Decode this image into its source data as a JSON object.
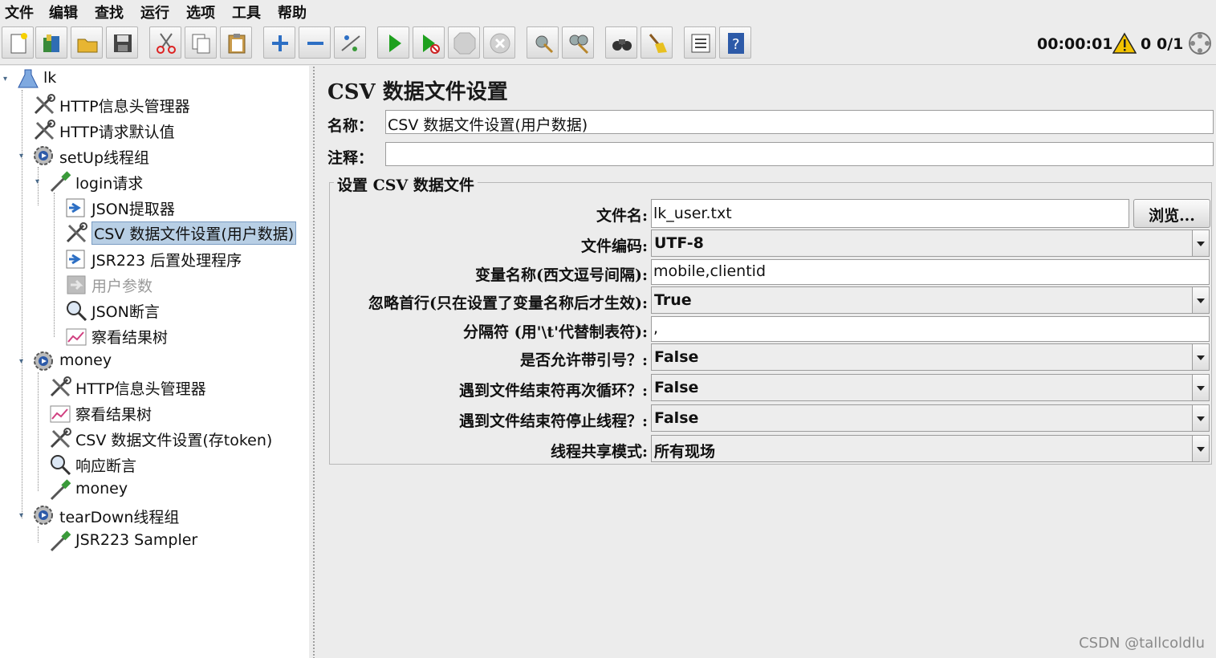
{
  "menu": [
    "文件",
    "编辑",
    "查找",
    "运行",
    "选项",
    "工具",
    "帮助"
  ],
  "toolbar": {
    "icons": [
      "new-icon",
      "templates-icon",
      "open-icon",
      "save-icon",
      "cut-icon",
      "copy-icon",
      "paste-icon",
      "expand-icon",
      "collapse-icon",
      "toggle-icon",
      "start-icon",
      "start-no-pause-icon",
      "stop-icon",
      "shutdown-icon",
      "clear-icon",
      "clear-all-icon",
      "search-icon",
      "reset-search-icon",
      "function-helper-icon",
      "help-icon"
    ],
    "timer": "00:00:01",
    "warning_count": "0",
    "threads": "0/1"
  },
  "tree": {
    "nodes": [
      {
        "label": "lk",
        "icon": "test-plan-icon"
      },
      {
        "label": "HTTP信息头管理器",
        "icon": "config-tool-icon"
      },
      {
        "label": "HTTP请求默认值",
        "icon": "config-tool-icon"
      },
      {
        "label": "setUp线程组",
        "icon": "thread-group-gear-icon"
      },
      {
        "label": "login请求",
        "icon": "sampler-pipette-icon"
      },
      {
        "label": "JSON提取器",
        "icon": "post-processor-icon"
      },
      {
        "label": "CSV 数据文件设置(用户数据)",
        "icon": "config-tool-icon"
      },
      {
        "label": "JSR223 后置处理程序",
        "icon": "post-processor-icon"
      },
      {
        "label": "用户参数",
        "icon": "pre-processor-icon"
      },
      {
        "label": "JSON断言",
        "icon": "assertion-magnifier-icon"
      },
      {
        "label": "察看结果树",
        "icon": "listener-graph-icon"
      },
      {
        "label": "money",
        "icon": "thread-group-gear-icon"
      },
      {
        "label": "HTTP信息头管理器",
        "icon": "config-tool-icon"
      },
      {
        "label": "察看结果树",
        "icon": "listener-graph-icon"
      },
      {
        "label": "CSV 数据文件设置(存token)",
        "icon": "config-tool-icon"
      },
      {
        "label": "响应断言",
        "icon": "assertion-magnifier-icon"
      },
      {
        "label": "money",
        "icon": "sampler-pipette-icon"
      },
      {
        "label": "tearDown线程组",
        "icon": "thread-group-gear-icon"
      },
      {
        "label": "JSR223 Sampler",
        "icon": "sampler-pipette-icon"
      }
    ]
  },
  "panel": {
    "title": "CSV 数据文件设置",
    "name_label": "名称：",
    "name_value": "CSV 数据文件设置(用户数据)",
    "comment_label": "注释：",
    "comment_value": "",
    "group_title": "设置 CSV 数据文件",
    "filename_label": "文件名:",
    "filename_value": "lk_user.txt",
    "browse_label": "浏览...",
    "encoding_label": "文件编码:",
    "encoding_value": "UTF-8",
    "varnames_label": "变量名称(西文逗号间隔):",
    "varnames_value": "mobile,clientid",
    "ignore_first_label": "忽略首行(只在设置了变量名称后才生效):",
    "ignore_first_value": "True",
    "delimiter_label": "分隔符 (用'\\t'代替制表符):",
    "delimiter_value": ",",
    "quoted_label": "是否允许带引号？:",
    "quoted_value": "False",
    "recycle_label": "遇到文件结束符再次循环？:",
    "recycle_value": "False",
    "stop_thread_label": "遇到文件结束符停止线程？:",
    "stop_thread_value": "False",
    "sharing_label": "线程共享模式:",
    "sharing_value": "所有现场"
  },
  "watermark": "CSDN @tallcoldlu",
  "colors": {
    "selection": "#b8cfe5",
    "start_green": "#1ea01e",
    "warning_yellow": "#f2c200",
    "help_blue": "#2d5aa8"
  }
}
